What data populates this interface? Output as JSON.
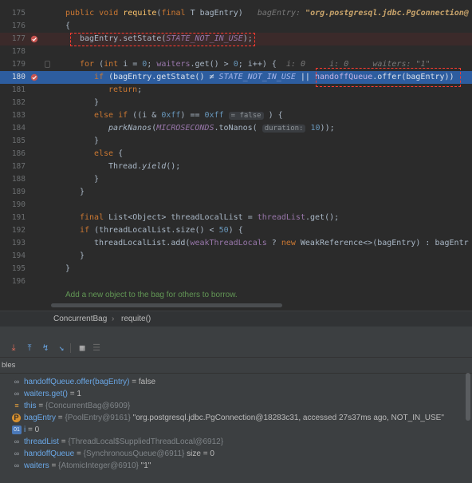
{
  "editor": {
    "lines": [
      {
        "n": "175"
      },
      {
        "n": "176"
      },
      {
        "n": "177"
      },
      {
        "n": "178"
      },
      {
        "n": "179"
      },
      {
        "n": "180"
      },
      {
        "n": "181"
      },
      {
        "n": "182"
      },
      {
        "n": "183"
      },
      {
        "n": "184"
      },
      {
        "n": "185"
      },
      {
        "n": "186"
      },
      {
        "n": "187"
      },
      {
        "n": "188"
      },
      {
        "n": "189"
      },
      {
        "n": "190"
      },
      {
        "n": "191"
      },
      {
        "n": "192"
      },
      {
        "n": "193"
      },
      {
        "n": "194"
      },
      {
        "n": "195"
      },
      {
        "n": "196"
      }
    ],
    "code": {
      "l175_kw": "public void",
      "l175_name": "requite",
      "l175_open": "(",
      "l175_final": "final",
      "l175_params": " T bagEntry)",
      "l175_hint_label": "bagEntry:",
      "l175_hint_value": "\"org.postgresql.jdbc.PgConnection@",
      "l176": "{",
      "l177_obj": "bagEntry.",
      "l177_method": "setState",
      "l177_open": "(",
      "l177_const": "STATE_NOT_IN_USE",
      "l177_close": ");",
      "l179_for": "for",
      "l179_open": " (",
      "l179_int": "int",
      "l179_i": " i = ",
      "l179_zero": "0",
      "l179_semi": "; ",
      "l179_waiters": "waiters",
      "l179_get": ".get() > ",
      "l179_zero2": "0",
      "l179_rest": "; i++) {",
      "l179_hint": "i: 0     i: 0     waiters: \"1\"",
      "l180_if": "if",
      "l180_cond": " (bagEntry.getState() ≠ ",
      "l180_const": "STATE_NOT_IN_USE",
      "l180_or": " || ",
      "l180_queue": "handoffQueue",
      "l180_offer": ".offer(bagEntry))",
      "l181_return": "return",
      "l181_semi": ";",
      "l182": "}",
      "l183_else": "else if",
      "l183_cond": " ((i & ",
      "l183_hex": "0xff",
      "l183_eq": ") == ",
      "l183_hex2": "0xff",
      "l183_hint": "= false",
      "l183_close": " ) {",
      "l184_method": "parkNanos",
      "l184_open": "(",
      "l184_const": "MICROSECONDS",
      "l184_to": ".toNanos(",
      "l184_param": "duration:",
      "l184_num": "10",
      "l184_close": "));",
      "l185": "}",
      "l186_else": "else",
      "l186_brace": " {",
      "l187_cls": "Thread.",
      "l187_method": "yield",
      "l187_close": "();",
      "l188": "}",
      "l189": "}",
      "l191_final": "final",
      "l191_decl": " List<Object> threadLocalList = ",
      "l191_field": "threadList",
      "l191_get": ".get();",
      "l192_if": "if",
      "l192_cond": " (threadLocalList.size() < ",
      "l192_num": "50",
      "l192_close": ") {",
      "l193_call": "threadLocalList.add(",
      "l193_field": "weakThreadLocals",
      "l193_q": " ? ",
      "l193_new": "new",
      "l193_rest": " WeakReference<>(bagEntry) : bagEntr",
      "l194": "}",
      "l195": "}"
    },
    "doc_hint": "Add a new object to the bag for others to borrow."
  },
  "breadcrumb": {
    "class_name": "ConcurrentBag",
    "separator": "›",
    "method_name": "requite()"
  },
  "debug": {
    "toolbar_icons": [
      "step-into-icon",
      "step-out-icon",
      "force-step-into-icon",
      "run-to-cursor-icon",
      "evaluate-icon",
      "frames-icon"
    ],
    "variables_header": "bles",
    "variables": [
      {
        "icon": "∞",
        "kind": "watch",
        "name": "handoffQueue.offer(bagEntry)",
        "eq": " = ",
        "type": "",
        "value": "false"
      },
      {
        "icon": "∞",
        "kind": "watch",
        "name": "waiters.get()",
        "eq": " = ",
        "type": "",
        "value": "1"
      },
      {
        "icon": "≡",
        "kind": "this",
        "name": "this",
        "eq": " = ",
        "type": "{ConcurrentBag@6909}",
        "value": ""
      },
      {
        "icon": "P",
        "kind": "param",
        "name": "bagEntry",
        "eq": " = ",
        "type": "{PoolEntry@9161}",
        "value": " \"org.postgresql.jdbc.PgConnection@18283c31, accessed 27s37ms ago, NOT_IN_USE\""
      },
      {
        "icon": "01",
        "kind": "local",
        "name": "i",
        "eq": " = ",
        "type": "",
        "value": "0"
      },
      {
        "icon": "∞",
        "kind": "field",
        "name": "threadList",
        "eq": " = ",
        "type": "{ThreadLocal$SuppliedThreadLocal@6912}",
        "value": ""
      },
      {
        "icon": "∞",
        "kind": "field",
        "name": "handoffQueue",
        "eq": " = ",
        "type": "{SynchronousQueue@6911}",
        "value": "  size = 0"
      },
      {
        "icon": "∞",
        "kind": "field",
        "name": "waiters",
        "eq": " = ",
        "type": "{AtomicInteger@6910}",
        "value": " \"1\""
      }
    ]
  },
  "colors": {
    "editor_bg": "#2b2b2b",
    "execution_line": "#2d5d9f",
    "breakpoint_line": "#3b2a2a",
    "breakpoint": "#c75450",
    "annotation_box": "#ff3b30"
  }
}
